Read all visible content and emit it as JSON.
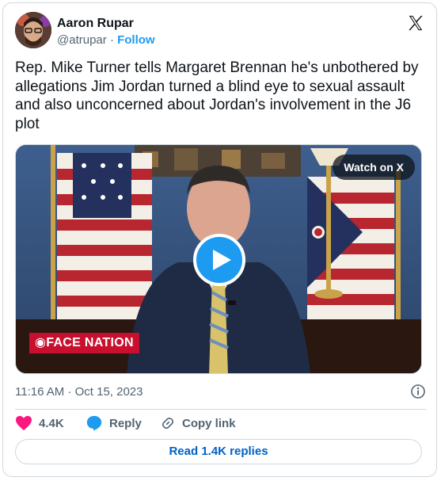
{
  "author": {
    "name": "Aaron Rupar",
    "handle": "@atrupar",
    "separator": "·",
    "follow_label": "Follow"
  },
  "tweet": {
    "text": "Rep. Mike Turner tells Margaret Brennan he's unbothered by allegations Jim Jordan turned a blind eye to sexual assault and also unconcerned about Jordan's involvement in the J6 plot",
    "timestamp": "11:16 AM · Oct 15, 2023"
  },
  "media": {
    "watch_label": "Watch on X",
    "logo_text": "◉FACE NATION"
  },
  "actions": {
    "like_count": "4.4K",
    "reply_label": "Reply",
    "copy_link_label": "Copy link"
  },
  "footer": {
    "read_replies_label": "Read 1.4K replies"
  },
  "colors": {
    "accent": "#1d9bf0",
    "like": "#f91880",
    "link": "#0063c3",
    "secondary_text": "#536471"
  },
  "icons": [
    "x-logo-icon",
    "play-icon",
    "info-icon",
    "heart-icon",
    "reply-bubble-icon",
    "link-icon"
  ]
}
